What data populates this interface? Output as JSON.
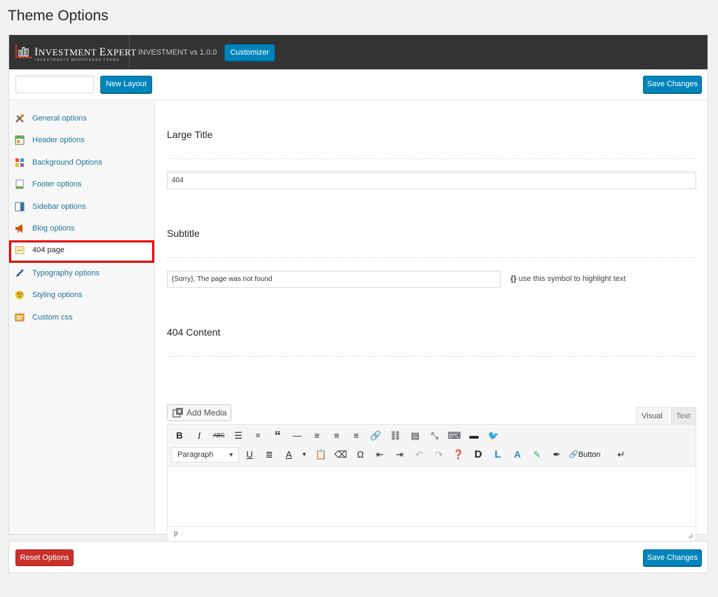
{
  "page": {
    "title": "Theme Options"
  },
  "topbar": {
    "logo_name_first": "I",
    "logo_name_rest": "NVESTMENT ",
    "logo_name2_first": "E",
    "logo_name2_rest": "XPERT",
    "logo_tagline": "INVESTMENTS WORDPRESS THEME",
    "version": "INVESTMENT vs 1.0.0",
    "customizer_label": "Customizer"
  },
  "toolbar": {
    "layout_input_value": "",
    "new_layout_label": "New Layout",
    "save_label": "Save Changes"
  },
  "sidebar": {
    "items": [
      {
        "label": "General options",
        "icon": "tools-icon"
      },
      {
        "label": "Header options",
        "icon": "header-icon"
      },
      {
        "label": "Background Options",
        "icon": "palette-icon"
      },
      {
        "label": "Footer options",
        "icon": "footer-icon"
      },
      {
        "label": "Sidebar options",
        "icon": "sidebar-icon"
      },
      {
        "label": "Blog options",
        "icon": "megaphone-icon"
      },
      {
        "label": "404 page",
        "icon": "page-icon"
      },
      {
        "label": "Typography options",
        "icon": "pen-icon"
      },
      {
        "label": "Styling options",
        "icon": "brush-icon"
      },
      {
        "label": "Custom css",
        "icon": "css-icon"
      }
    ],
    "active_index": 6
  },
  "main": {
    "large_title": {
      "heading": "Large Title",
      "value": "404"
    },
    "subtitle": {
      "heading": "Subtitle",
      "value": "{Sorry}, The page was not found",
      "hint_symbol": "{}",
      "hint_text": " use this symbol to highlight text"
    },
    "content": {
      "heading": "404 Content",
      "add_media_label": "Add Media",
      "tab_visual": "Visual",
      "tab_text": "Text",
      "format_select": "Paragraph",
      "button_label": "Button",
      "status_path": "p"
    }
  },
  "footer": {
    "reset_label": "Reset Options",
    "save_label": "Save Changes"
  },
  "colors": {
    "primary": "#0085ba",
    "danger": "#c9302c",
    "active_outline": "#e00000",
    "link": "#21759b",
    "topbar": "#333333"
  }
}
